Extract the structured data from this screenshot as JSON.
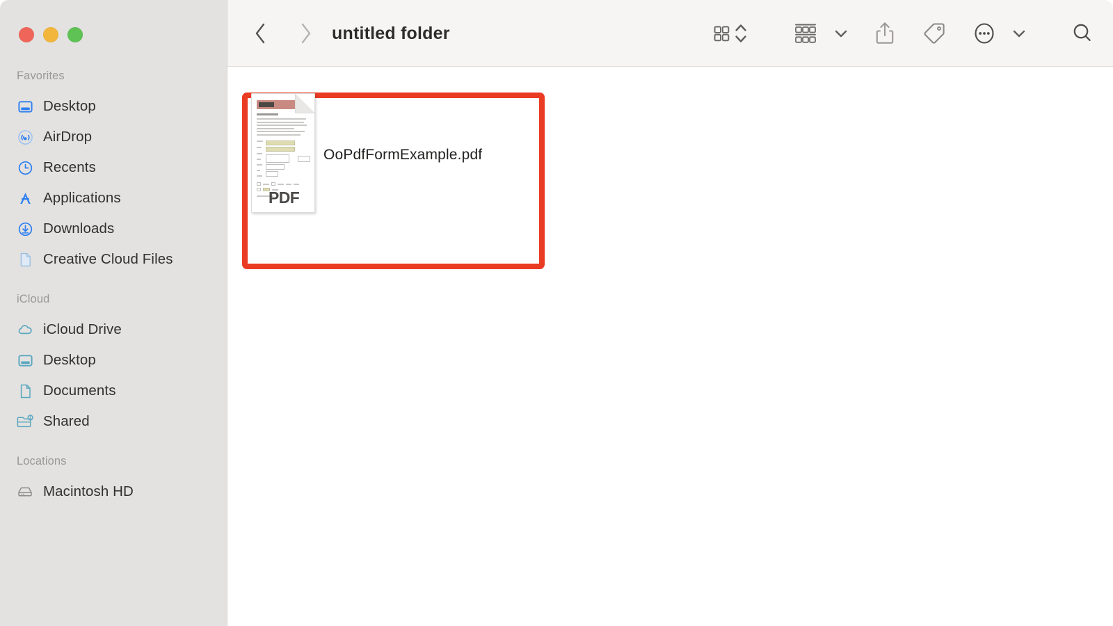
{
  "window": {
    "traffic_lights": [
      {
        "name": "close",
        "color": "#f0655a"
      },
      {
        "name": "minimize",
        "color": "#f2b63c"
      },
      {
        "name": "maximize",
        "color": "#5fc254"
      }
    ]
  },
  "toolbar": {
    "back_label": "‹",
    "forward_label": "›",
    "title": "untitled folder",
    "buttons": [
      {
        "name": "icon-view-button",
        "icon": "grid-icon"
      },
      {
        "name": "view-stepper",
        "icon": "chevron-updown-icon"
      },
      {
        "name": "group-by-button",
        "icon": "group-rows-icon"
      },
      {
        "name": "group-by-chevron",
        "icon": "chevron-down-icon"
      },
      {
        "name": "share-button",
        "icon": "share-icon"
      },
      {
        "name": "tag-button",
        "icon": "tag-icon"
      },
      {
        "name": "more-button",
        "icon": "ellipsis-circle-icon"
      },
      {
        "name": "more-chevron",
        "icon": "chevron-down-icon"
      },
      {
        "name": "search-button",
        "icon": "search-icon"
      }
    ]
  },
  "sidebar": {
    "groups": [
      {
        "title": "Favorites",
        "items": [
          {
            "label": "Desktop",
            "icon": "desktop-icon",
            "color": "#2f7ff0"
          },
          {
            "label": "AirDrop",
            "icon": "airdrop-icon",
            "color": "#2f7ff0"
          },
          {
            "label": "Recents",
            "icon": "clock-icon",
            "color": "#2f7ff0"
          },
          {
            "label": "Applications",
            "icon": "applications-icon",
            "color": "#2f7ff0"
          },
          {
            "label": "Downloads",
            "icon": "download-icon",
            "color": "#2f7ff0"
          },
          {
            "label": "Creative Cloud Files",
            "icon": "document-icon",
            "color": "#9dbfe0"
          }
        ]
      },
      {
        "title": "iCloud",
        "items": [
          {
            "label": "iCloud Drive",
            "icon": "cloud-icon",
            "color": "#5aa7c0"
          },
          {
            "label": "Desktop",
            "icon": "desktop-icon",
            "color": "#5aa7c0"
          },
          {
            "label": "Documents",
            "icon": "document-icon",
            "color": "#5aa7c0"
          },
          {
            "label": "Shared",
            "icon": "shared-folder-icon",
            "color": "#5aa7c0"
          }
        ]
      },
      {
        "title": "Locations",
        "items": [
          {
            "label": "Macintosh HD",
            "icon": "harddisk-icon",
            "color": "#8b8a88"
          }
        ]
      }
    ]
  },
  "content": {
    "files": [
      {
        "name": "OoPdfFormExample.pdf",
        "kind": "pdf-document",
        "thumbnail_label": "PDF",
        "selected": false,
        "highlighted": true
      }
    ],
    "highlight_color": "#ea3b23"
  }
}
